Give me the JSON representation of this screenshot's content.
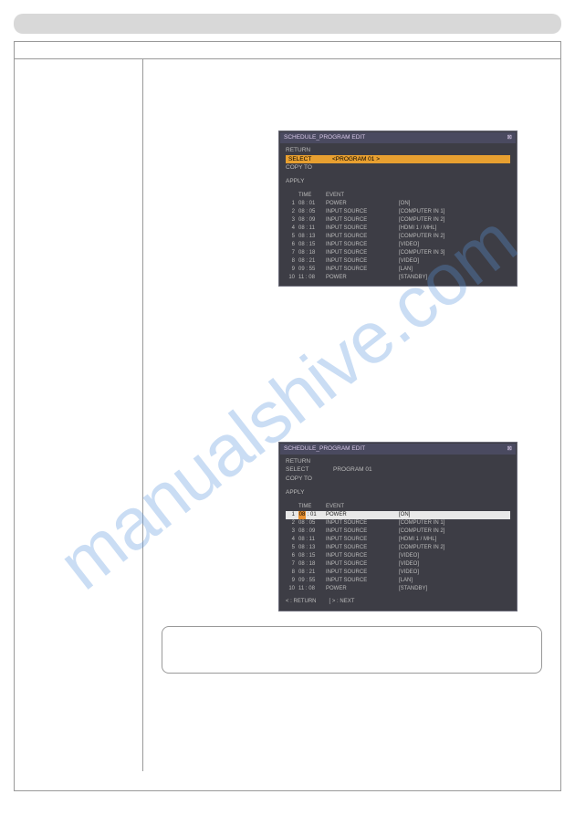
{
  "watermark": "manualshive.com",
  "dialog1": {
    "title": "SCHEDULE_PROGRAM EDIT",
    "return": "RETURN",
    "select": "SELECT",
    "selectVal": "<PROGRAM 01      >",
    "copyTo": "COPY TO",
    "apply": "APPLY",
    "header": {
      "time": "TIME",
      "event": "EVENT"
    },
    "rows": [
      {
        "n": "1",
        "time": "08 : 01",
        "event": "POWER",
        "val": "[ON]"
      },
      {
        "n": "2",
        "time": "08 : 05",
        "event": "INPUT SOURCE",
        "val": "[COMPUTER IN 1]"
      },
      {
        "n": "3",
        "time": "08 : 09",
        "event": "INPUT SOURCE",
        "val": "[COMPUTER IN 2]"
      },
      {
        "n": "4",
        "time": "08 : 11",
        "event": "INPUT SOURCE",
        "val": "[HDMI 1 / MHL]"
      },
      {
        "n": "5",
        "time": "08 : 13",
        "event": "INPUT SOURCE",
        "val": "[COMPUTER IN 2]"
      },
      {
        "n": "6",
        "time": "08 : 15",
        "event": "INPUT SOURCE",
        "val": "[VIDEO]"
      },
      {
        "n": "7",
        "time": "08 : 18",
        "event": "INPUT SOURCE",
        "val": "[COMPUTER IN 3]"
      },
      {
        "n": "8",
        "time": "08 : 21",
        "event": "INPUT SOURCE",
        "val": "[VIDEO]"
      },
      {
        "n": "9",
        "time": "09 : 55",
        "event": "INPUT SOURCE",
        "val": "[LAN]"
      },
      {
        "n": "10",
        "time": "11 : 08",
        "event": "POWER",
        "val": "[STANDBY]"
      }
    ]
  },
  "dialog2": {
    "title": "SCHEDULE_PROGRAM EDIT",
    "return": "RETURN",
    "select": "SELECT",
    "selectVal": "PROGRAM 01",
    "copyTo": "COPY TO",
    "apply": "APPLY",
    "header": {
      "time": "TIME",
      "event": "EVENT"
    },
    "rows": [
      {
        "n": "1",
        "time": "08 : 01",
        "event": "POWER",
        "val": "[ON]"
      },
      {
        "n": "2",
        "time": "08 : 05",
        "event": "INPUT SOURCE",
        "val": "[COMPUTER IN 1]"
      },
      {
        "n": "3",
        "time": "08 : 09",
        "event": "INPUT SOURCE",
        "val": "[COMPUTER IN 2]"
      },
      {
        "n": "4",
        "time": "08 : 11",
        "event": "INPUT SOURCE",
        "val": "[HDMI 1 / MHL]"
      },
      {
        "n": "5",
        "time": "08 : 13",
        "event": "INPUT SOURCE",
        "val": "[COMPUTER IN 2]"
      },
      {
        "n": "6",
        "time": "08 : 15",
        "event": "INPUT SOURCE",
        "val": "[VIDEO]"
      },
      {
        "n": "7",
        "time": "08 : 18",
        "event": "INPUT SOURCE",
        "val": "[VIDEO]"
      },
      {
        "n": "8",
        "time": "08 : 21",
        "event": "INPUT SOURCE",
        "val": "[VIDEO]"
      },
      {
        "n": "9",
        "time": "09 : 55",
        "event": "INPUT SOURCE",
        "val": "[LAN]"
      },
      {
        "n": "10",
        "time": "11 : 08",
        "event": "POWER",
        "val": "[STANDBY]"
      }
    ],
    "hints": {
      "ret": "< : RETURN",
      "next": "[ > : NEXT"
    }
  }
}
